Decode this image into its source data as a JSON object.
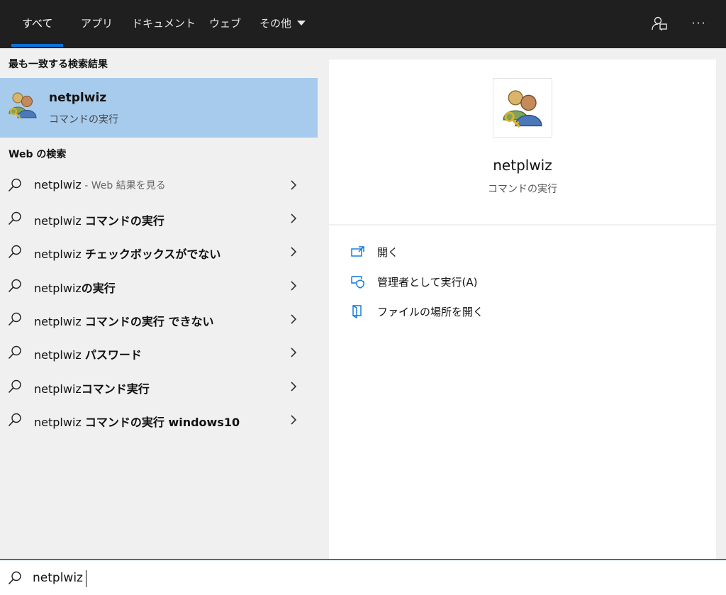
{
  "tabs": [
    {
      "label": "すべて",
      "active": true
    },
    {
      "label": "アプリ"
    },
    {
      "label": "ドキュメント"
    },
    {
      "label": "ウェブ"
    },
    {
      "label": "その他"
    }
  ],
  "topbar": {
    "feedback_icon": "feedback-person-icon",
    "more_label": "···"
  },
  "best_match": {
    "section_title": "最も一致する検索結果",
    "name": "netplwiz",
    "subtitle": "コマンドの実行",
    "icon": "users-key-icon"
  },
  "web": {
    "section_title": "Web の検索",
    "items": [
      {
        "term": "netplwiz",
        "suffix_bold": "",
        "suffix_dim": " - Web 結果を見る"
      },
      {
        "term": "netplwiz ",
        "suffix_bold": "コマンドの実行",
        "suffix_dim": ""
      },
      {
        "term": "netplwiz ",
        "suffix_bold": "チェックボックスがでない",
        "suffix_dim": ""
      },
      {
        "term": "netplwiz",
        "suffix_bold": "の実行",
        "suffix_dim": ""
      },
      {
        "term": "netplwiz ",
        "suffix_bold": "コマンドの実行 できない",
        "suffix_dim": ""
      },
      {
        "term": "netplwiz ",
        "suffix_bold": "パスワード",
        "suffix_dim": ""
      },
      {
        "term": "netplwiz",
        "suffix_bold": "コマンド実行",
        "suffix_dim": ""
      },
      {
        "term": "netplwiz ",
        "suffix_bold": "コマンドの実行 windows10",
        "suffix_dim": ""
      }
    ]
  },
  "details": {
    "name": "netplwiz",
    "subtitle": "コマンドの実行",
    "actions": [
      {
        "label": "開く",
        "icon": "open-icon"
      },
      {
        "label": "管理者として実行(A)",
        "icon": "run-as-admin-icon"
      },
      {
        "label": "ファイルの場所を開く",
        "icon": "file-location-icon"
      }
    ]
  },
  "search": {
    "value": "netplwiz",
    "placeholder": ""
  },
  "colors": {
    "accent": "#0a74da",
    "selected": "#a7cbec",
    "topbar": "#1f1f1f"
  }
}
